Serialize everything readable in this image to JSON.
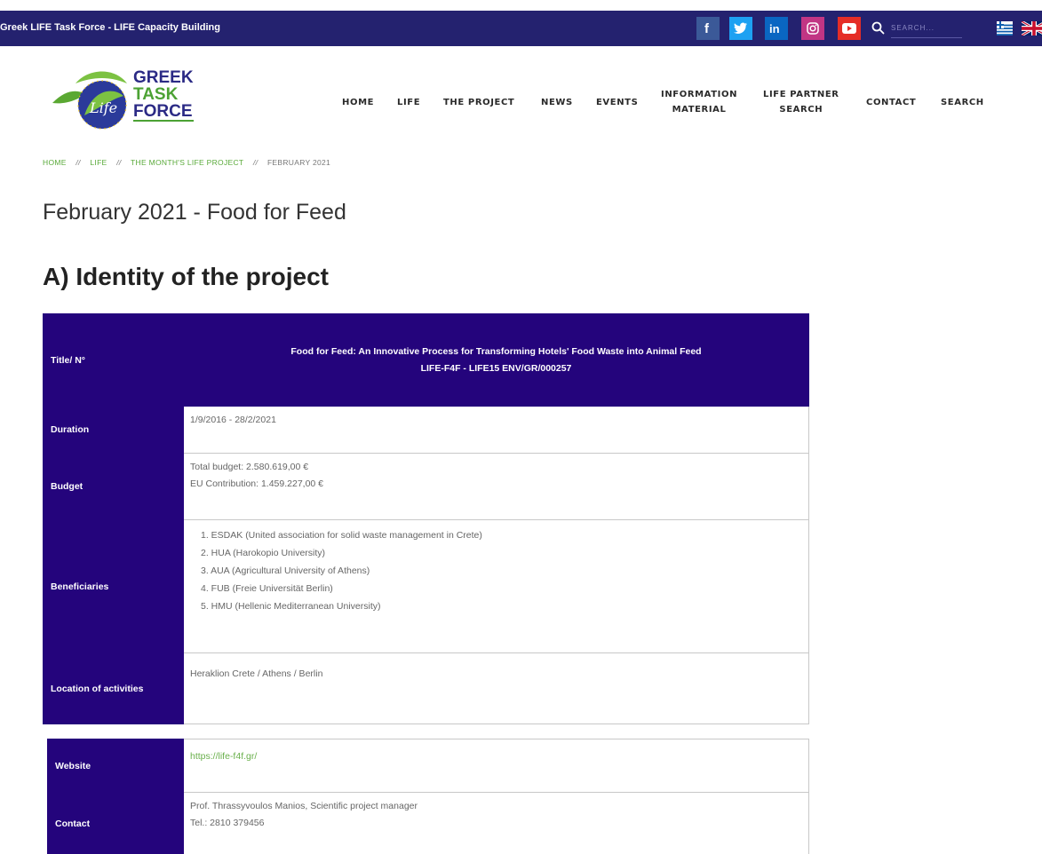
{
  "topbar": {
    "title": "Greek LIFE Task Force - LIFE Capacity Building",
    "search_placeholder": "SEARCH...",
    "social": [
      "facebook-icon",
      "twitter-icon",
      "linkedin-icon",
      "instagram-icon",
      "youtube-icon"
    ],
    "languages": [
      "greek-flag-icon",
      "uk-flag-icon"
    ]
  },
  "logo": {
    "line1": "GREEK",
    "line2": "TASK",
    "line3": "FORCE",
    "emblem_text": "Life"
  },
  "nav": {
    "home": "HOME",
    "life": "LIFE",
    "project": "THE PROJECT",
    "news": "NEWS",
    "events": "EVENTS",
    "info_1": "INFORMATION",
    "info_2": "MATERIAL",
    "partner_1": "LIFE PARTNER",
    "partner_2": "SEARCH",
    "contact": "CONTACT",
    "search": "SEARCH"
  },
  "breadcrumb": {
    "home": "HOME",
    "life": "LIFE",
    "month_project": "THE MONTH'S LIFE PROJECT",
    "current": "FEBRUARY 2021",
    "sep": "//"
  },
  "page_title": "February 2021 - Food for Feed",
  "section_title": "A) Identity of the project",
  "table": {
    "title_label": "Title/ N°",
    "title_line1": "Food for Feed: An Innovative Process for Transforming Hotels' Food Waste into Animal Feed",
    "title_line2": "LIFE-F4F - LIFE15 ENV/GR/000257",
    "duration_label": "Duration",
    "duration_value": "1/9/2016 - 28/2/2021",
    "budget_label": "Budget",
    "budget_total": "Total budget: 2.580.619,00 €",
    "budget_eu": "EU Contribution: 1.459.227,00 €",
    "beneficiaries_label": "Beneficiaries",
    "beneficiaries": [
      "1. ESDAK (United association for solid waste management in Crete)",
      "2. HUA (Harokopio University)",
      "3. AUA (Agricultural University of Athens)",
      "4. FUB (Freie Universität Berlin)",
      "5. HMU (Hellenic Mediterranean University)"
    ],
    "location_label": "Location of activities",
    "location_value": "Heraklion Crete / Athens / Berlin",
    "website_label": "Website",
    "website_value": "https://life-f4f.gr/",
    "contact_label": "Contact",
    "contact_name": "Prof. Thrassyvoulos Manios, Scientific project manager",
    "contact_tel": "Tel.: 2810 379456"
  },
  "colors": {
    "topbar": "#24226f",
    "table_label": "#24047c",
    "link": "#6ab04c",
    "breadcrumb_link": "#5aaa3a"
  }
}
